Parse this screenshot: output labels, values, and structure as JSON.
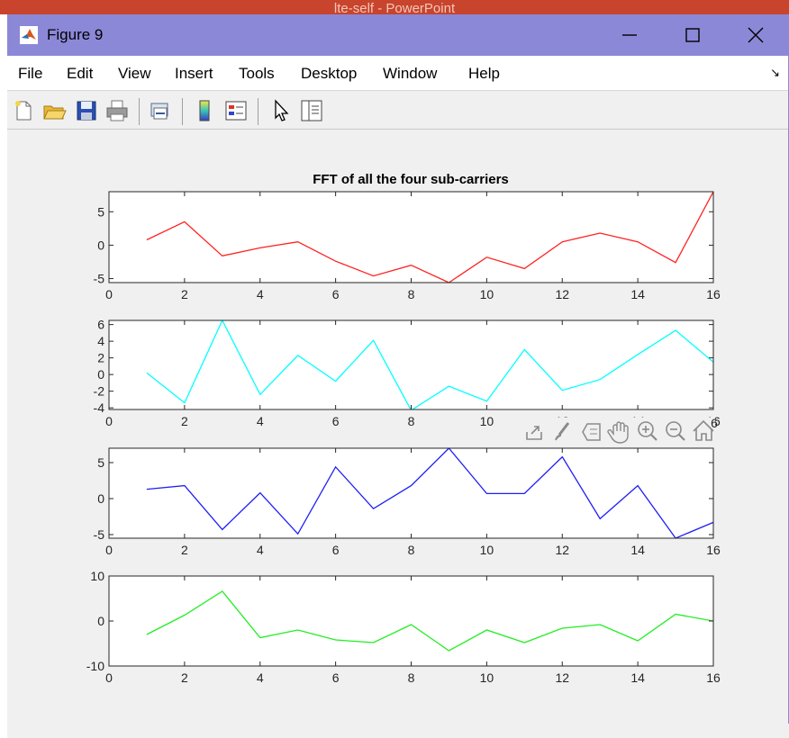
{
  "background_app": {
    "title": "lte-self  -  PowerPoint"
  },
  "window": {
    "title": "Figure 9",
    "controls": {
      "minimize": "minimize-icon",
      "maximize": "maximize-icon",
      "close": "close-icon"
    }
  },
  "menubar": {
    "items": [
      "File",
      "Edit",
      "View",
      "Insert",
      "Tools",
      "Desktop",
      "Window",
      "Help"
    ],
    "overflow_icon": "dock-arrow-icon"
  },
  "toolbar": {
    "buttons": [
      {
        "name": "new-figure",
        "icon": "new-file-icon"
      },
      {
        "name": "open-file",
        "icon": "folder-open-icon"
      },
      {
        "name": "save",
        "icon": "floppy-disk-icon"
      },
      {
        "name": "print",
        "icon": "printer-icon"
      },
      {
        "name": "link-plot",
        "icon": "link-plot-icon"
      },
      {
        "name": "insert-colorbar",
        "icon": "colorbar-icon"
      },
      {
        "name": "insert-legend",
        "icon": "legend-icon"
      },
      {
        "name": "edit-plot",
        "icon": "pointer-arrow-icon"
      },
      {
        "name": "property-inspector",
        "icon": "panel-icon"
      }
    ]
  },
  "axes_toolbar": {
    "buttons": [
      "export-icon",
      "brush-icon",
      "data-tips-icon",
      "pan-hand-icon",
      "zoom-in-icon",
      "zoom-out-icon",
      "home-icon"
    ]
  },
  "colors": {
    "titlebar": "#8c88d8",
    "series1": "#ff2222",
    "series2": "#00ffff",
    "series3": "#1f1ff5",
    "series4": "#22ee22"
  },
  "chart_data": [
    {
      "type": "line",
      "title": "FFT of all the four sub-carriers",
      "color": "#ff2222",
      "xlim": [
        0,
        16
      ],
      "ylim": [
        -5.6,
        8
      ],
      "xticks": [
        0,
        2,
        4,
        6,
        8,
        10,
        12,
        14,
        16
      ],
      "yticks": [
        -5,
        0,
        5
      ],
      "x": [
        1,
        2,
        3,
        4,
        5,
        6,
        7,
        8,
        9,
        10,
        11,
        12,
        13,
        14,
        15,
        16
      ],
      "values": [
        0.8,
        3.5,
        -1.6,
        -0.4,
        0.5,
        -2.4,
        -4.6,
        -3.0,
        -5.6,
        -1.8,
        -3.5,
        0.5,
        1.8,
        0.5,
        -2.6,
        8.0
      ]
    },
    {
      "type": "line",
      "title": "",
      "color": "#00ffff",
      "xlim": [
        0,
        16
      ],
      "ylim": [
        -4.2,
        6.5
      ],
      "xticks": [
        0,
        2,
        4,
        6,
        8,
        10,
        12,
        14,
        16
      ],
      "yticks": [
        -4,
        -2,
        0,
        2,
        4,
        6
      ],
      "x": [
        1,
        2,
        3,
        4,
        5,
        6,
        7,
        8,
        9,
        10,
        11,
        12,
        13,
        14,
        15,
        16
      ],
      "values": [
        0.2,
        -3.4,
        6.5,
        -2.4,
        2.3,
        -0.8,
        4.1,
        -4.3,
        -1.4,
        -3.2,
        3.0,
        -1.9,
        -0.6,
        2.4,
        5.3,
        1.5
      ]
    },
    {
      "type": "line",
      "title": "",
      "color": "#1f1ff5",
      "xlim": [
        0,
        16
      ],
      "ylim": [
        -5.5,
        7
      ],
      "xticks": [
        0,
        2,
        4,
        6,
        8,
        10,
        12,
        14,
        16
      ],
      "yticks": [
        -5,
        0,
        5
      ],
      "x": [
        1,
        2,
        3,
        4,
        5,
        6,
        7,
        8,
        9,
        10,
        11,
        12,
        13,
        14,
        15,
        16
      ],
      "values": [
        1.3,
        1.8,
        -4.3,
        0.8,
        -4.9,
        4.4,
        -1.4,
        1.8,
        7.0,
        0.7,
        0.7,
        5.8,
        -2.8,
        1.8,
        -5.5,
        -3.3
      ]
    },
    {
      "type": "line",
      "title": "",
      "color": "#22ee22",
      "xlim": [
        0,
        16
      ],
      "ylim": [
        -10,
        10
      ],
      "xticks": [
        0,
        2,
        4,
        6,
        8,
        10,
        12,
        14,
        16
      ],
      "yticks": [
        -10,
        0,
        10
      ],
      "x": [
        1,
        2,
        3,
        4,
        5,
        6,
        7,
        8,
        9,
        10,
        11,
        12,
        13,
        14,
        15,
        16
      ],
      "values": [
        -3.0,
        1.3,
        6.6,
        -3.7,
        -2.0,
        -4.2,
        -4.8,
        -0.8,
        -6.6,
        -2.0,
        -4.8,
        -1.6,
        -0.8,
        -4.4,
        1.5,
        0.0
      ]
    }
  ]
}
